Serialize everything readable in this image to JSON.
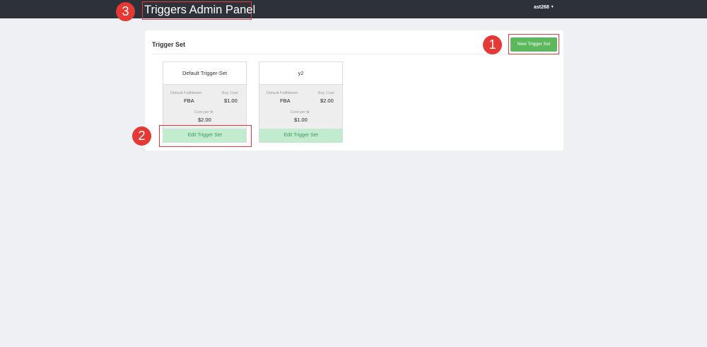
{
  "header": {
    "app_title": "Triggers Admin Panel",
    "user": "ast268",
    "caret": "▼"
  },
  "annotations": [
    "1",
    "2",
    "3"
  ],
  "panel": {
    "title": "Trigger Set",
    "new_button_label": "New Trigger Set"
  },
  "cards": [
    {
      "name": "Default Trigger-Set",
      "fulfillment_label": "Default Fulfillment",
      "fulfillment": "FBA",
      "buy_cost_label": "Buy Cost",
      "buy_cost": "$1.00",
      "cost_per_lb_label": "Cost per lb",
      "cost_per_lb": "$2.00",
      "edit_label": "Edit Trigger Set"
    },
    {
      "name": "y2",
      "fulfillment_label": "Default Fulfillment",
      "fulfillment": "FBA",
      "buy_cost_label": "Buy Cost",
      "buy_cost": "$2.00",
      "cost_per_lb_label": "Cost per lb",
      "cost_per_lb": "$1.00",
      "edit_label": "Edit Trigger Set"
    }
  ],
  "colors": {
    "topbar": "#2d3139",
    "accent_green": "#5cb85c",
    "annotation_red": "#e53935"
  }
}
